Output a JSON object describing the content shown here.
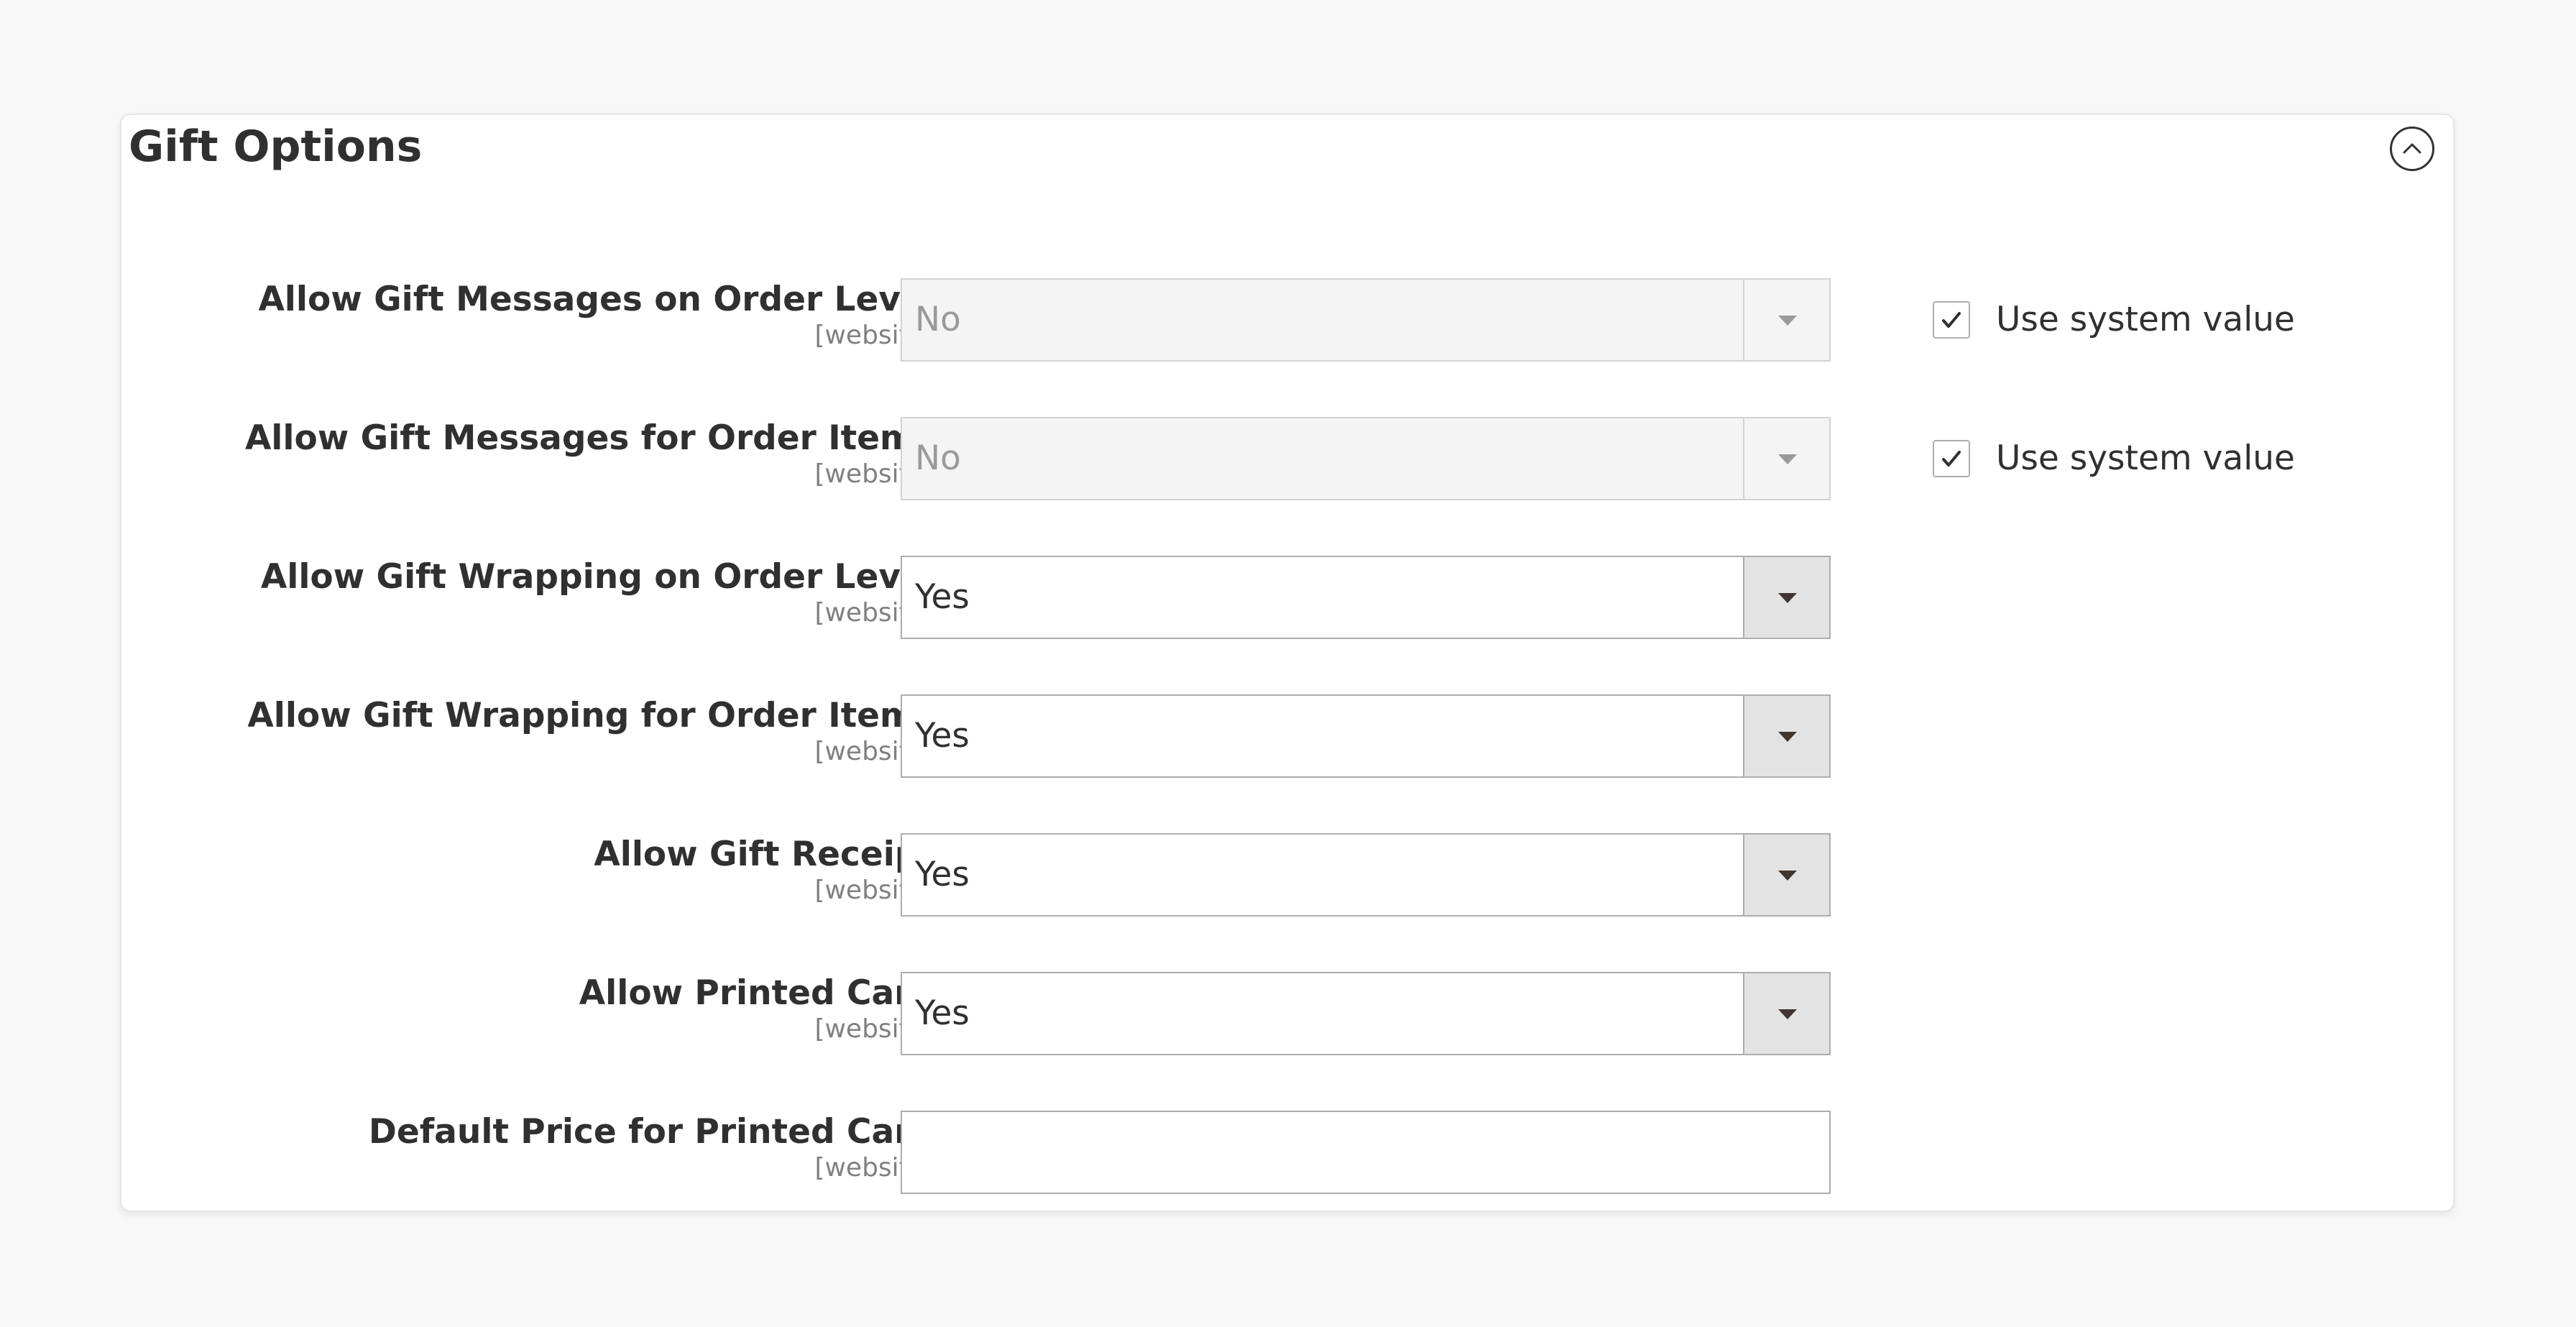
{
  "section": {
    "title": "Gift Options"
  },
  "fields": [
    {
      "label": "Allow Gift Messages on Order Level",
      "scope": "[website]",
      "value": "No",
      "disabled": true,
      "use_system_value": true
    },
    {
      "label": "Allow Gift Messages for Order Items",
      "scope": "[website]",
      "value": "No",
      "disabled": true,
      "use_system_value": true
    },
    {
      "label": "Allow Gift Wrapping on Order Level",
      "scope": "[website]",
      "value": "Yes",
      "disabled": false
    },
    {
      "label": "Allow Gift Wrapping for Order Items",
      "scope": "[website]",
      "value": "Yes",
      "disabled": false
    },
    {
      "label": "Allow Gift Receipt",
      "scope": "[website]",
      "value": "Yes",
      "disabled": false
    },
    {
      "label": "Allow Printed Card",
      "scope": "[website]",
      "value": "Yes",
      "disabled": false
    },
    {
      "label": "Default Price for Printed Card",
      "scope": "[website]",
      "value": "",
      "disabled": false
    }
  ],
  "system_value_label": "Use system value",
  "icons": {
    "collapse": "chevron-up-circle-icon",
    "dropdown": "triangle-down-icon",
    "check": "checkmark-icon"
  },
  "colors": {
    "text": "#303030",
    "scope_text": "#808080",
    "border": "#adadad",
    "disabled_bg": "#f4f4f4",
    "arrow_bg": "#e3e3e3"
  }
}
